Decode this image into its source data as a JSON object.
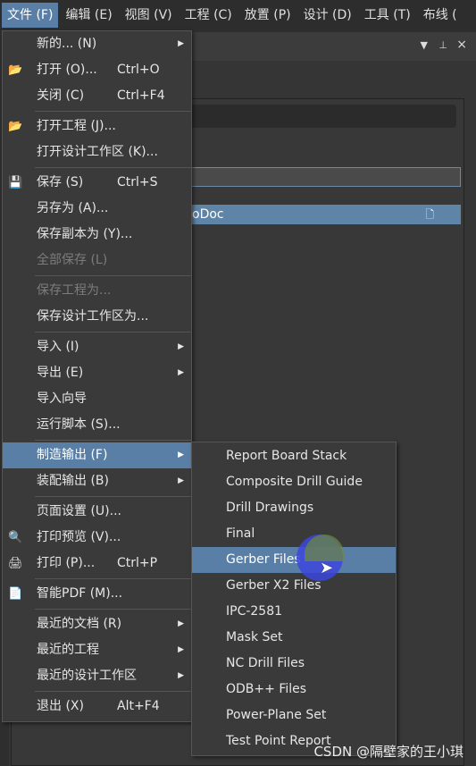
{
  "menubar": {
    "items": [
      "文件 (F)",
      "编辑 (E)",
      "视图 (V)",
      "工程 (C)",
      "放置 (P)",
      "设计 (D)",
      "工具 (T)",
      "布线 ("
    ],
    "active": 0
  },
  "panel": {
    "doc_text": "oDoc",
    "icons": {
      "dropdown": "▼",
      "pin": "📌",
      "close": "×",
      "doc": "🗋"
    }
  },
  "file_menu": [
    {
      "label": "新的... (N)",
      "submenu": true
    },
    {
      "label": "打开 (O)...",
      "shortcut": "Ctrl+O",
      "icon": "folder-open-icon"
    },
    {
      "label": "关闭 (C)",
      "shortcut": "Ctrl+F4"
    },
    {
      "sep": true
    },
    {
      "label": "打开工程 (J)...",
      "icon": "folder-open-icon"
    },
    {
      "label": "打开设计工作区 (K)..."
    },
    {
      "sep": true
    },
    {
      "label": "保存 (S)",
      "shortcut": "Ctrl+S",
      "icon": "save-icon"
    },
    {
      "label": "另存为 (A)..."
    },
    {
      "label": "保存副本为 (Y)..."
    },
    {
      "label": "全部保存 (L)",
      "disabled": true
    },
    {
      "sep": true
    },
    {
      "label": "保存工程为...",
      "disabled": true
    },
    {
      "label": "保存设计工作区为..."
    },
    {
      "sep": true
    },
    {
      "label": "导入 (I)",
      "submenu": true
    },
    {
      "label": "导出 (E)",
      "submenu": true
    },
    {
      "label": "导入向导"
    },
    {
      "label": "运行脚本 (S)..."
    },
    {
      "sep": true
    },
    {
      "label": "制造输出 (F)",
      "submenu": true,
      "highlighted": true
    },
    {
      "label": "装配输出 (B)",
      "submenu": true
    },
    {
      "sep": true
    },
    {
      "label": "页面设置 (U)..."
    },
    {
      "label": "打印预览 (V)...",
      "icon": "print-preview-icon"
    },
    {
      "label": "打印 (P)...",
      "shortcut": "Ctrl+P",
      "icon": "printer-icon"
    },
    {
      "sep": true
    },
    {
      "label": "智能PDF (M)...",
      "icon": "pdf-icon"
    },
    {
      "sep": true
    },
    {
      "label": "最近的文档 (R)",
      "submenu": true
    },
    {
      "label": "最近的工程",
      "submenu": true
    },
    {
      "label": "最近的设计工作区",
      "submenu": true
    },
    {
      "sep": true
    },
    {
      "label": "退出 (X)",
      "shortcut": "Alt+F4"
    }
  ],
  "fabrication_submenu": [
    {
      "label": "Report Board Stack"
    },
    {
      "label": "Composite Drill Guide"
    },
    {
      "label": "Drill Drawings"
    },
    {
      "label": "Final"
    },
    {
      "label": "Gerber Files",
      "highlighted": true
    },
    {
      "label": "Gerber X2 Files"
    },
    {
      "label": "IPC-2581"
    },
    {
      "label": "Mask Set"
    },
    {
      "label": "NC Drill Files"
    },
    {
      "label": "ODB++ Files"
    },
    {
      "label": "Power-Plane Set"
    },
    {
      "label": "Test Point Report"
    }
  ],
  "watermark": "CSDN @隔壁家的王小琪",
  "colors": {
    "highlight": "#5a7fa6",
    "menu_bg": "#3a3a3a"
  }
}
